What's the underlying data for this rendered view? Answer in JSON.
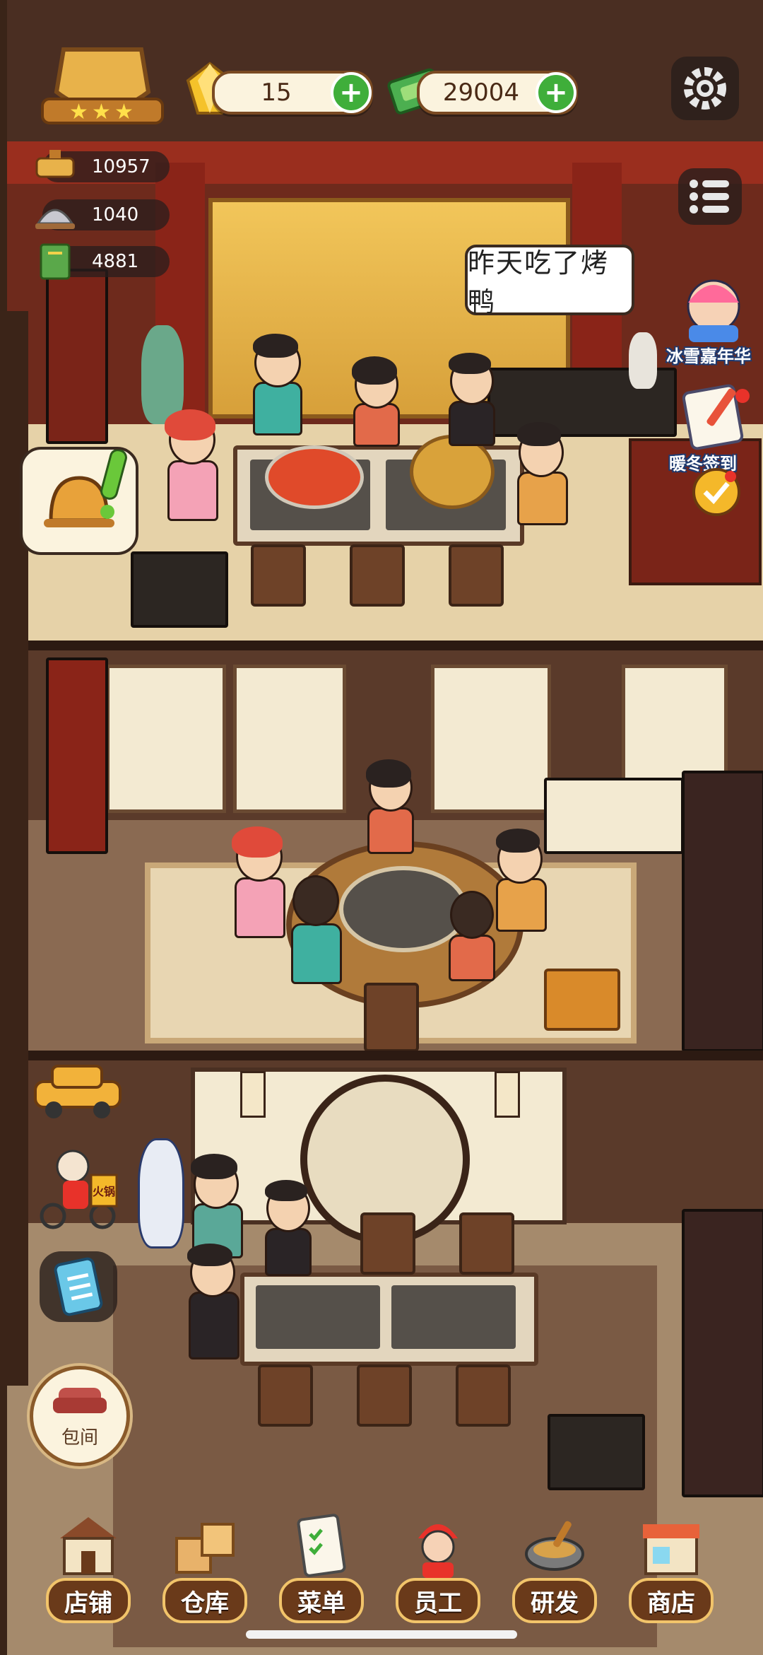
{
  "hud": {
    "gems": "15",
    "cash": "29004",
    "stats": [
      "10957",
      "1040",
      "4881"
    ],
    "rating_stars": 3
  },
  "speech_bubble": "昨天吃了烤鸭",
  "events": {
    "carnival": "冰雪嘉年华",
    "checkin": "暖冬签到"
  },
  "side": {
    "private_room": "包间",
    "shop_sign": "火锅"
  },
  "nav": [
    "店铺",
    "仓库",
    "菜单",
    "员工",
    "研发",
    "商店"
  ],
  "colors": {
    "accent_gold": "#f2c46a",
    "plus_green": "#3fae3a",
    "nav_brown": "#6a3a1a"
  }
}
